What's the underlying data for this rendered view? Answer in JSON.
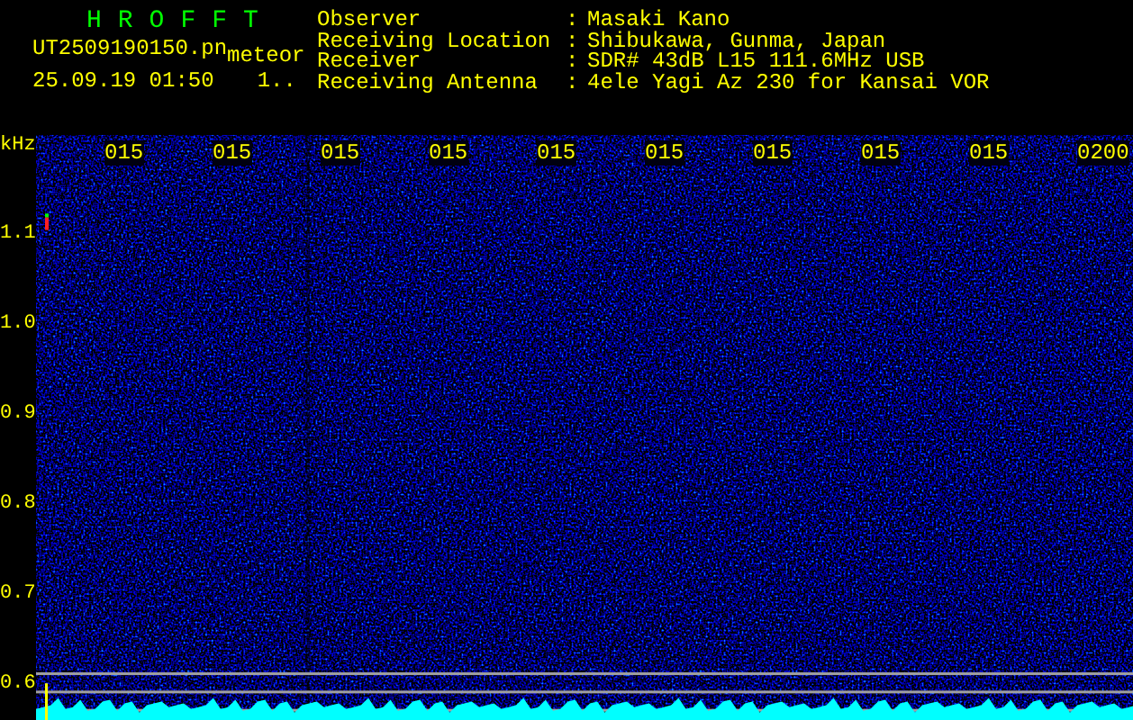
{
  "app_title": "HROFFT",
  "file_name": "UT2509190150.pn",
  "mode": "meteor",
  "date_time": "25.09.19 01:50",
  "counter": "1..",
  "info": [
    {
      "label": "Observer",
      "separator": ":",
      "value": "Masaki Kano"
    },
    {
      "label": "Receiving Location",
      "separator": ":",
      "value": "Shibukawa, Gunma, Japan"
    },
    {
      "label": "Receiver",
      "separator": ":",
      "value": "SDR# 43dB L15 111.6MHz USB"
    },
    {
      "label": "Receiving Antenna",
      "separator": ":",
      "value": "4ele Yagi Az 230 for Kansai VOR"
    }
  ],
  "y_axis": {
    "unit": "kHz",
    "ticks": [
      "1.1",
      "1.0",
      "0.9",
      "0.8",
      "0.7",
      "0.6"
    ]
  },
  "time_labels": [
    "015",
    "015",
    "015",
    "015",
    "015",
    "015",
    "015",
    "015",
    "015",
    "0200"
  ]
}
